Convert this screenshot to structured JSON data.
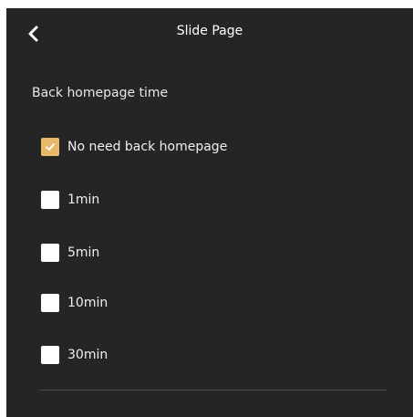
{
  "header": {
    "title": "Slide Page",
    "back_icon": "chevron-left-icon"
  },
  "section": {
    "label": "Back homepage time"
  },
  "options": [
    {
      "label": "No need back homepage",
      "checked": true
    },
    {
      "label": "1min",
      "checked": false
    },
    {
      "label": "5min",
      "checked": false
    },
    {
      "label": "10min",
      "checked": false
    },
    {
      "label": "30min",
      "checked": false
    }
  ],
  "colors": {
    "background": "#252525",
    "accent": "#e9b869",
    "text": "#ffffff"
  }
}
